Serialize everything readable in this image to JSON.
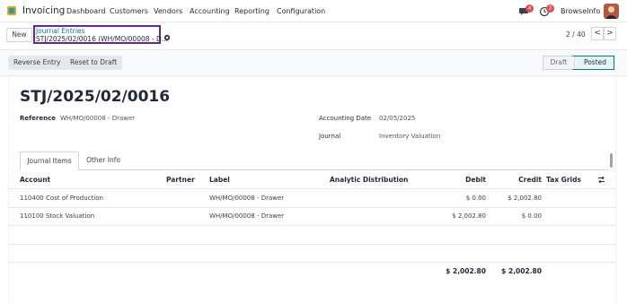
{
  "navbar": {
    "app_name": "Invoicing",
    "menus": [
      "Dashboard",
      "Customers",
      "Vendors",
      "Accounting",
      "Reporting",
      "Configuration"
    ],
    "messages_count": "4",
    "activities_count": "2",
    "company": "BrowseInfo"
  },
  "control": {
    "new_label": "New",
    "breadcrumb_parent": "Journal Entries",
    "breadcrumb_current": "STJ/2025/02/0016 (WH/MO/00008 - D...",
    "pager": "2 / 40",
    "prev": "<",
    "next": ">"
  },
  "actions": {
    "reverse_entry": "Reverse Entry",
    "reset_to_draft": "Reset to Draft"
  },
  "status": {
    "draft": "Draft",
    "posted": "Posted"
  },
  "form": {
    "title": "STJ/2025/02/0016",
    "reference_label": "Reference",
    "reference_value": "WH/MO/00008 - Drawer",
    "accounting_date_label": "Accounting Date",
    "accounting_date_value": "02/05/2025",
    "journal_label": "Journal",
    "journal_value": "Inventory Valuation"
  },
  "tabs": [
    "Journal Items",
    "Other Info"
  ],
  "table": {
    "headers": {
      "account": "Account",
      "partner": "Partner",
      "label": "Label",
      "analytic": "Analytic Distribution",
      "debit": "Debit",
      "credit": "Credit",
      "tax_grids": "Tax Grids"
    },
    "rows": [
      {
        "account": "110400 Cost of Production",
        "partner": "",
        "label": "WH/MO/00008 - Drawer",
        "analytic": "",
        "debit": "$ 0.00",
        "credit": "$ 2,002.80"
      },
      {
        "account": "110100 Stock Valuation",
        "partner": "",
        "label": "WH/MO/00008 - Drawer",
        "analytic": "",
        "debit": "$ 2,002.80",
        "credit": "$ 0.00"
      }
    ],
    "total_debit": "$ 2,002.80",
    "total_credit": "$ 2,002.80"
  }
}
